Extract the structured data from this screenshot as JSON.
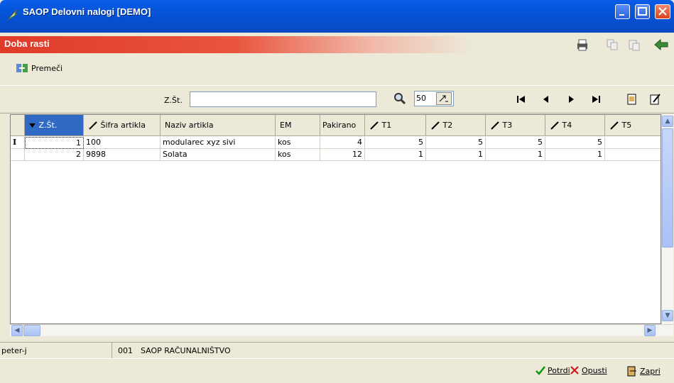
{
  "window": {
    "title": "SAOP Delovni nalogi [DEMO]"
  },
  "subheader": {
    "title": "Doba rasti"
  },
  "toolbar": {
    "move_label": "Premeči"
  },
  "filter": {
    "zst_label": "Z.Št.",
    "zst_value": "",
    "page_size": "50"
  },
  "grid": {
    "columns": [
      "Z.Št.",
      "Šifra artikla",
      "Naziv artikla",
      "EM",
      "Pakirano",
      "T1",
      "T2",
      "T3",
      "T4",
      "T5"
    ],
    "rows": [
      {
        "zst": "1",
        "sifra": "100",
        "naziv": "modularec xyz sivi",
        "em": "kos",
        "pakirano": "4",
        "t1": "5",
        "t2": "5",
        "t3": "5",
        "t4": "5",
        "t5": ""
      },
      {
        "zst": "2",
        "sifra": "9898",
        "naziv": "Solata",
        "em": "kos",
        "pakirano": "12",
        "t1": "1",
        "t2": "1",
        "t3": "1",
        "t4": "1",
        "t5": ""
      }
    ],
    "row_indicator": "I"
  },
  "status": {
    "user": "peter-j",
    "code": "001",
    "company": "SAOP RAČUNALNIŠTVO"
  },
  "footer": {
    "confirm_label": "Potrdi",
    "cancel_label": "Opusti",
    "close_label": "Zapri"
  },
  "colors": {
    "title_blue": "#0453d6",
    "subheader_red": "#e03a2a"
  }
}
